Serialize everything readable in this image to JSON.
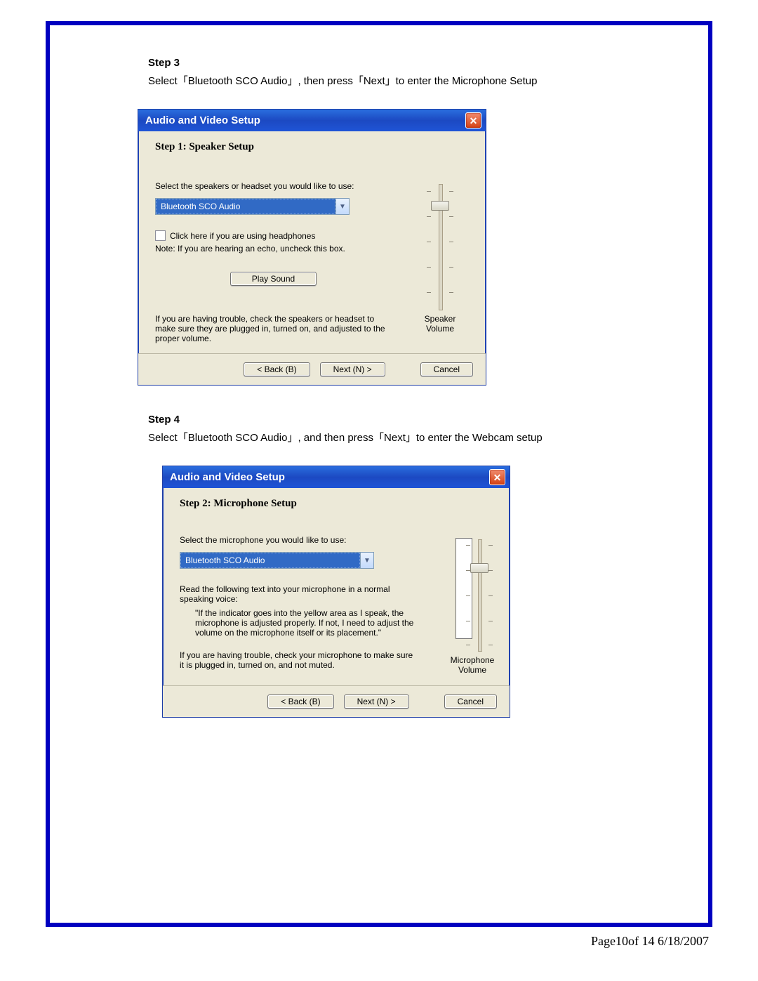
{
  "page": {
    "footer": "Page10of 14     6/18/2007"
  },
  "step3": {
    "heading": "Step 3",
    "caption": "Select「Bluetooth SCO Audio」, then press「Next」to enter the Microphone Setup"
  },
  "step4": {
    "heading": "Step 4",
    "caption": "Select「Bluetooth SCO Audio」, and then press「Next」to enter the Webcam setup"
  },
  "dialog1": {
    "title": "Audio and Video Setup",
    "step_title": "Step 1: Speaker Setup",
    "prompt": "Select the speakers or headset you would like to use:",
    "combo_value": "Bluetooth SCO Audio",
    "checkbox_label": "Click here if you are using headphones",
    "note": "Note: If you are hearing an echo, uncheck this box.",
    "play_btn": "Play Sound",
    "trouble": "If you are having trouble, check the speakers or headset to make sure they are plugged in, turned on, and adjusted to the proper volume.",
    "slider_label_1": "Speaker",
    "slider_label_2": "Volume",
    "back": "<  Back  (B)",
    "next": "Next  (N) >",
    "cancel": "Cancel"
  },
  "dialog2": {
    "title": "Audio and Video Setup",
    "step_title": "Step 2: Microphone Setup",
    "prompt": "Select the microphone you would like to use:",
    "combo_value": "Bluetooth SCO Audio",
    "read_intro": "Read the following text into your microphone in a normal speaking voice:",
    "read_quote": "\"If the indicator goes into the yellow area as I speak, the microphone is adjusted properly.  If not, I need to adjust the volume on the microphone itself or its placement.\"",
    "trouble": "If you are having trouble, check your microphone to make sure it is plugged in, turned on, and not muted.",
    "slider_label_1": "Microphone",
    "slider_label_2": "Volume",
    "back": "<  Back  (B)",
    "next": "Next  (N) >",
    "cancel": "Cancel"
  }
}
